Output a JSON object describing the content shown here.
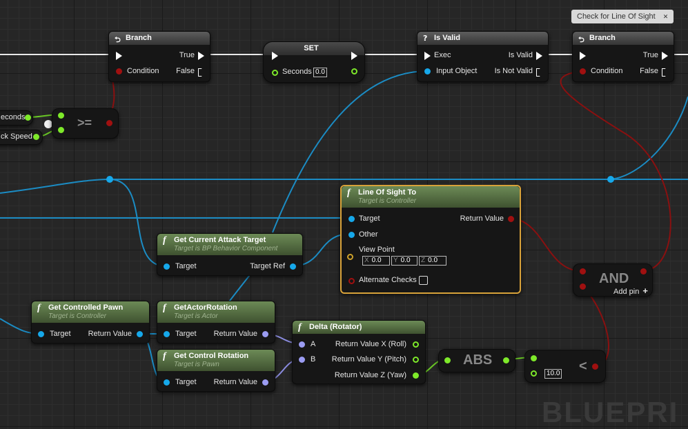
{
  "comment_box": {
    "label": "Check for Line Of Sight"
  },
  "watermark": "BLUEPRI",
  "nodes": {
    "branch1": {
      "title": "Branch",
      "true_label": "True",
      "false_label": "False",
      "condition_label": "Condition"
    },
    "set": {
      "title": "SET",
      "seconds_label": "Seconds",
      "seconds_value": "0.0"
    },
    "is_valid": {
      "title": "Is Valid",
      "exec_label": "Exec",
      "is_valid_label": "Is Valid",
      "input_object_label": "Input Object",
      "is_not_valid_label": "Is Not Valid"
    },
    "branch2": {
      "title": "Branch",
      "true_label": "True",
      "false_label": "False",
      "condition_label": "Condition"
    },
    "gte": {
      "op": ">="
    },
    "var_seconds": {
      "label": "econds"
    },
    "var_speed": {
      "label": "ck Speed"
    },
    "line_of_sight": {
      "title": "Line Of Sight To",
      "subtitle": "Target is Controller",
      "target_label": "Target",
      "return_label": "Return Value",
      "other_label": "Other",
      "viewpoint_label": "View Point",
      "x": "0.0",
      "y": "0.0",
      "z": "0.0",
      "x_label": "X",
      "y_label": "Y",
      "z_label": "Z",
      "alt_label": "Alternate Checks"
    },
    "get_attack_target": {
      "title": "Get Current Attack Target",
      "subtitle": "Target is BP Behavior Component",
      "target_label": "Target",
      "return_label": "Target Ref"
    },
    "get_controlled_pawn": {
      "title": "Get Controlled Pawn",
      "subtitle": "Target is Controller",
      "target_label": "Target",
      "return_label": "Return Value"
    },
    "get_actor_rotation": {
      "title": "GetActorRotation",
      "subtitle": "Target is Actor",
      "target_label": "Target",
      "return_label": "Return Value"
    },
    "get_control_rotation": {
      "title": "Get Control Rotation",
      "subtitle": "Target is Pawn",
      "target_label": "Target",
      "return_label": "Return Value"
    },
    "delta_rotator": {
      "title": "Delta (Rotator)",
      "a_label": "A",
      "b_label": "B",
      "rx": "Return Value X (Roll)",
      "ry": "Return Value Y (Pitch)",
      "rz": "Return Value Z (Yaw)"
    },
    "abs": {
      "op": "ABS"
    },
    "less": {
      "op": "<",
      "value": "10.0"
    },
    "and": {
      "op": "AND",
      "add_pin": "Add pin"
    }
  },
  "colors": {
    "exec": "#ffffff",
    "object": "#16a8ea",
    "float": "#7ee92a",
    "bool": "#a01010",
    "rotator": "#9b9cf2",
    "vector": "#cda12b"
  }
}
